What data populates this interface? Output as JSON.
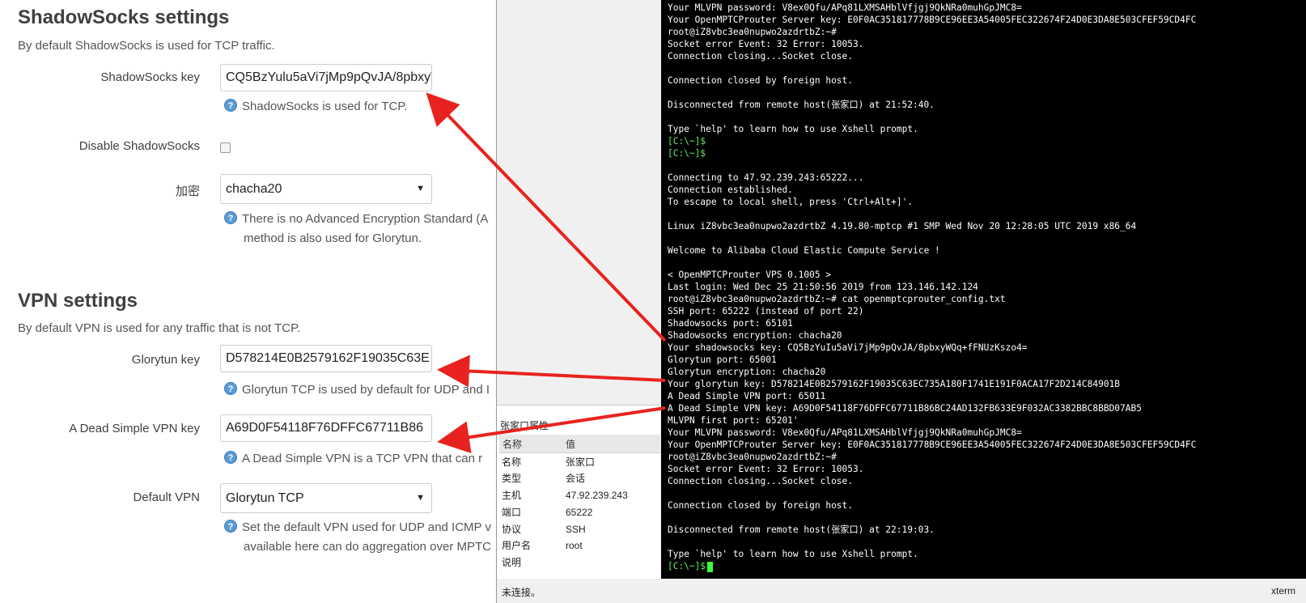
{
  "shadowsocks": {
    "title": "ShadowSocks settings",
    "description": "By default ShadowSocks is used for TCP traffic.",
    "key_label": "ShadowSocks key",
    "key_value": "CQ5BzYulu5aVi7jMp9pQvJA/8pbxyW",
    "key_help": "ShadowSocks is used for TCP.",
    "disable_label": "Disable ShadowSocks",
    "encryption_label": "加密",
    "encryption_value": "chacha20",
    "encryption_help_line1": "There is no Advanced Encryption Standard (A",
    "encryption_help_line2": "method is also used for Glorytun."
  },
  "vpn": {
    "title": "VPN settings",
    "description": "By default VPN is used for any traffic that is not TCP.",
    "glorytun_label": "Glorytun key",
    "glorytun_value": "D578214E0B2579162F19035C63E",
    "glorytun_help": "Glorytun TCP is used by default for UDP and I",
    "dsvpn_label": "A Dead Simple VPN key",
    "dsvpn_value": "A69D0F54118F76DFFC67711B86",
    "dsvpn_help": "A Dead Simple VPN is a TCP VPN that can r",
    "default_label": "Default VPN",
    "default_value": "Glorytun TCP",
    "default_help_line1": "Set the default VPN used for UDP and ICMP v",
    "default_help_line2": "available here can do aggregation over MPTC"
  },
  "help_glyph": "?",
  "caret_glyph": "▼",
  "session_props": {
    "title": "张家口属性",
    "col_name": "名称",
    "col_value": "值",
    "rows": [
      {
        "k": "名称",
        "v": "张家口"
      },
      {
        "k": "类型",
        "v": "会话"
      },
      {
        "k": "主机",
        "v": "47.92.239.243"
      },
      {
        "k": "端口",
        "v": "65222"
      },
      {
        "k": "协议",
        "v": "SSH"
      },
      {
        "k": "用户名",
        "v": "root"
      },
      {
        "k": "说明",
        "v": ""
      }
    ]
  },
  "terminal": {
    "lines": [
      {
        "text": "Your MLVPN password: V8ex0Qfu/APq81LXMSAHblVfjgj9QkNRa0muhGpJMC8=",
        "green": false
      },
      {
        "text": "Your OpenMPTCProuter Server key: E0F0AC351817778B9CE96EE3A54005FEC322674F24D0E3DA8E503CFEF59CD4FC",
        "green": false
      },
      {
        "text": "root@iZ8vbc3ea0nupwo2azdrtbZ:~#",
        "green": false
      },
      {
        "text": "Socket error Event: 32 Error: 10053.",
        "green": false
      },
      {
        "text": "Connection closing...Socket close.",
        "green": false
      },
      {
        "text": "",
        "green": false
      },
      {
        "text": "Connection closed by foreign host.",
        "green": false
      },
      {
        "text": "",
        "green": false
      },
      {
        "text": "Disconnected from remote host(张家口) at 21:52:40.",
        "green": false
      },
      {
        "text": "",
        "green": false
      },
      {
        "text": "Type `help' to learn how to use Xshell prompt.",
        "green": false
      },
      {
        "text": "[C:\\~]$",
        "green": true
      },
      {
        "text": "[C:\\~]$",
        "green": true
      },
      {
        "text": "",
        "green": false
      },
      {
        "text": "Connecting to 47.92.239.243:65222...",
        "green": false
      },
      {
        "text": "Connection established.",
        "green": false
      },
      {
        "text": "To escape to local shell, press 'Ctrl+Alt+]'.",
        "green": false
      },
      {
        "text": "",
        "green": false
      },
      {
        "text": "Linux iZ8vbc3ea0nupwo2azdrtbZ 4.19.80-mptcp #1 SMP Wed Nov 20 12:28:05 UTC 2019 x86_64",
        "green": false
      },
      {
        "text": "",
        "green": false
      },
      {
        "text": "Welcome to Alibaba Cloud Elastic Compute Service !",
        "green": false
      },
      {
        "text": "",
        "green": false
      },
      {
        "text": "< OpenMPTCProuter VPS 0.1005 >",
        "green": false
      },
      {
        "text": "Last login: Wed Dec 25 21:50:56 2019 from 123.146.142.124",
        "green": false
      },
      {
        "text": "root@iZ8vbc3ea0nupwo2azdrtbZ:~# cat openmptcprouter_config.txt",
        "green": false
      },
      {
        "text": "SSH port: 65222 (instead of port 22)",
        "green": false
      },
      {
        "text": "Shadowsocks port: 65101",
        "green": false
      },
      {
        "text": "Shadowsocks encryption: chacha20",
        "green": false
      },
      {
        "text": "Your shadowsocks key: CQ5BzYuIu5aVi7jMp9pQvJA/8pbxyWQq+fFNUzKszo4=",
        "green": false
      },
      {
        "text": "Glorytun port: 65001",
        "green": false
      },
      {
        "text": "Glorytun encryption: chacha20",
        "green": false
      },
      {
        "text": "Your glorytun key: D578214E0B2579162F19035C63EC735A180F1741E191F0ACA17F2D214C84901B",
        "green": false
      },
      {
        "text": "A Dead Simple VPN port: 65011",
        "green": false
      },
      {
        "text": "A Dead Simple VPN key: A69D0F54118F76DFFC67711B86BC24AD132FB633E9F032AC3382BBC8BBD07AB5",
        "green": false
      },
      {
        "text": "MLVPN first port: 65201'",
        "green": false
      },
      {
        "text": "Your MLVPN password: V8ex0Qfu/APq81LXMSAHblVfjgj9QkNRa0muhGpJMC8=",
        "green": false
      },
      {
        "text": "Your OpenMPTCProuter Server key: E0F0AC351817778B9CE96EE3A54005FEC322674F24D0E3DA8E503CFEF59CD4FC",
        "green": false
      },
      {
        "text": "root@iZ8vbc3ea0nupwo2azdrtbZ:~#",
        "green": false
      },
      {
        "text": "Socket error Event: 32 Error: 10053.",
        "green": false
      },
      {
        "text": "Connection closing...Socket close.",
        "green": false
      },
      {
        "text": "",
        "green": false
      },
      {
        "text": "Connection closed by foreign host.",
        "green": false
      },
      {
        "text": "",
        "green": false
      },
      {
        "text": "Disconnected from remote host(张家口) at 22:19:03.",
        "green": false
      },
      {
        "text": "",
        "green": false
      },
      {
        "text": "Type `help' to learn how to use Xshell prompt.",
        "green": false
      },
      {
        "text": "[C:\\~]$",
        "green": true
      }
    ]
  },
  "statusbar": {
    "left": "未连接。",
    "right": "xterm"
  },
  "colors": {
    "arrow": "#e8231f",
    "terminal_bg": "#000000",
    "prompt_green": "#5ff05f"
  }
}
